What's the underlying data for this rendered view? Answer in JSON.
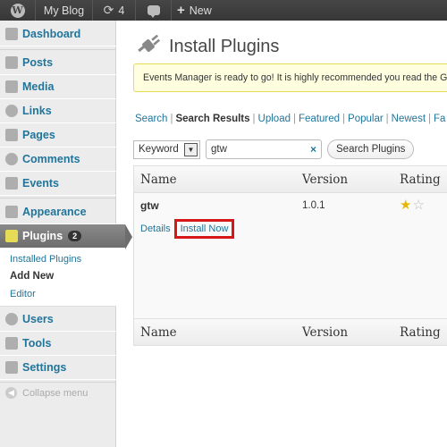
{
  "adminbar": {
    "site_name": "My Blog",
    "updates_count": "4",
    "new_label": "New"
  },
  "sidebar": {
    "items": [
      {
        "label": "Dashboard",
        "icon": "dashboard-icon"
      },
      {
        "label": "Posts",
        "icon": "pushpin-icon"
      },
      {
        "label": "Media",
        "icon": "media-icon"
      },
      {
        "label": "Links",
        "icon": "link-icon"
      },
      {
        "label": "Pages",
        "icon": "pages-icon"
      },
      {
        "label": "Comments",
        "icon": "comment-icon"
      },
      {
        "label": "Events",
        "icon": "calendar-icon"
      },
      {
        "label": "Appearance",
        "icon": "appearance-icon"
      },
      {
        "label": "Plugins",
        "icon": "plug-icon",
        "badge": "2"
      },
      {
        "label": "Users",
        "icon": "users-icon"
      },
      {
        "label": "Tools",
        "icon": "tools-icon"
      },
      {
        "label": "Settings",
        "icon": "settings-icon"
      }
    ],
    "plugins_submenu": [
      "Installed Plugins",
      "Add New",
      "Editor"
    ],
    "collapse_label": "Collapse menu"
  },
  "page": {
    "title": "Install Plugins",
    "notice": "Events Manager is ready to go! It is highly recommended you read the G",
    "tabs": [
      "Search",
      "Search Results",
      "Upload",
      "Featured",
      "Popular",
      "Newest",
      "Fa"
    ],
    "active_tab": "Search Results",
    "search": {
      "type_selected": "Keyword",
      "query": "gtw",
      "clear_glyph": "×",
      "button_label": "Search Plugins"
    },
    "table": {
      "headers": [
        "Name",
        "Version",
        "Rating"
      ],
      "rows": [
        {
          "name": "gtw",
          "version": "1.0.1",
          "details_label": "Details",
          "install_label": "Install Now",
          "rating_stars_filled": 1,
          "rating_stars_shown": 2
        }
      ]
    }
  },
  "colors": {
    "link": "#21759b",
    "highlight_box": "#d51717",
    "notice_bg": "#ffffe0",
    "adminbar_bg": "#464646"
  }
}
